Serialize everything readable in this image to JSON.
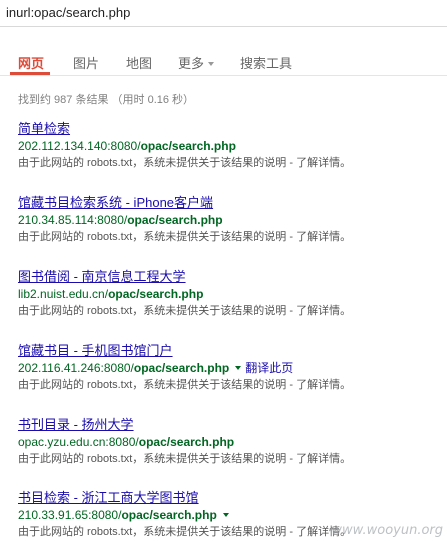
{
  "search": {
    "query": "inurl:opac/search.php"
  },
  "nav": {
    "tabs": [
      {
        "label": "网页"
      },
      {
        "label": "图片"
      },
      {
        "label": "地图"
      },
      {
        "label": "更多"
      },
      {
        "label": "搜索工具"
      }
    ]
  },
  "stats": "找到约 987 条结果 （用时 0.16 秒）",
  "results": [
    {
      "title": "简单检索",
      "url_host": "202.112.134.140:8080/",
      "url_path": "opac/search.php",
      "snippet_text": "由于此网站的 robots.txt，系统未提供关于该结果的说明 - ",
      "snippet_link": "了解详情。"
    },
    {
      "title": "馆藏书目检索系统 - iPhone客户端",
      "url_host": "210.34.85.114:8080/",
      "url_path": "opac/search.php",
      "snippet_text": "由于此网站的 robots.txt，系统未提供关于该结果的说明 - ",
      "snippet_link": "了解详情。"
    },
    {
      "title": "图书借阅 - 南京信息工程大学",
      "url_host": "lib2.nuist.edu.cn/",
      "url_path": "opac/search.php",
      "snippet_text": "由于此网站的 robots.txt，系统未提供关于该结果的说明 - ",
      "snippet_link": "了解详情。"
    },
    {
      "title": "馆藏书目 - 手机图书馆门户",
      "url_host": "202.116.41.246:8080/",
      "url_path": "opac/search.php",
      "translate": "翻译此页",
      "snippet_text": "由于此网站的 robots.txt，系统未提供关于该结果的说明 - ",
      "snippet_link": "了解详情。"
    },
    {
      "title": "书刊目录 - 扬州大学",
      "url_host": "opac.yzu.edu.cn:8080/",
      "url_path": "opac/search.php",
      "snippet_text": "由于此网站的 robots.txt，系统未提供关于该结果的说明 - ",
      "snippet_link": "了解详情。"
    },
    {
      "title": "书目检索 - 浙江工商大学图书馆",
      "url_host": "210.33.91.65:8080/",
      "url_path": "opac/search.php",
      "snippet_text": "由于此网站的 robots.txt，系统未提供关于该结果的说明 - ",
      "snippet_link": "了解详情。"
    }
  ],
  "watermark": "www.wooyun.org",
  "colors": {
    "active_tab": "#dd4b39",
    "link": "#1a0dab",
    "url": "#006621",
    "snippet": "#545454",
    "stats": "#808080"
  }
}
